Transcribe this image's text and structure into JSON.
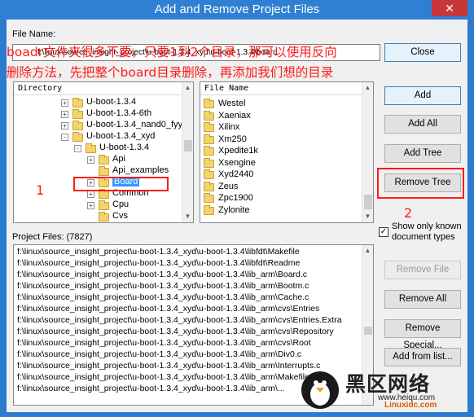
{
  "window": {
    "title": "Add and Remove Project Files",
    "close": "✕"
  },
  "labels": {
    "file_name": "File Name:",
    "directory": "Directory",
    "file_name_header": "File Name",
    "project_files": "Project Files: (7827)"
  },
  "filename_input": {
    "value": "f:\\linux\\source_insight_project\\u-boot-1.3.4_xyd\\u-boot-1.3.4\\board"
  },
  "buttons": {
    "close": "Close",
    "add": "Add",
    "add_all": "Add All",
    "add_tree": "Add Tree",
    "remove_tree": "Remove Tree",
    "remove_file": "Remove File",
    "remove_all": "Remove All",
    "remove_special": "Remove Special...",
    "add_from_list": "Add from list..."
  },
  "show_only_known": {
    "label_line1": "Show only known",
    "label_line2": "document types",
    "checked": true,
    "mark": "✓"
  },
  "directory_tree": [
    {
      "label": "U-boot-1.3.4",
      "expander": "+"
    },
    {
      "label": "U-boot-1.3.4-6th",
      "expander": "+"
    },
    {
      "label": "U-boot-1.3.4_nand0_fyy",
      "expander": "+"
    },
    {
      "label": "U-boot-1.3.4_xyd",
      "expander": "-"
    },
    {
      "label": "U-boot-1.3.4",
      "expander": "-"
    },
    {
      "label": "Api",
      "expander": "+"
    },
    {
      "label": "Api_examples",
      "expander": ""
    },
    {
      "label": "Board",
      "expander": "+"
    },
    {
      "label": "Common",
      "expander": "+"
    },
    {
      "label": "Cpu",
      "expander": "+"
    },
    {
      "label": "Cvs",
      "expander": ""
    }
  ],
  "file_list": [
    "Westel",
    "Xaeniax",
    "Xilinx",
    "Xm250",
    "Xpedite1k",
    "Xsengine",
    "Xyd2440",
    "Zeus",
    "Zpc1900",
    "Zylonite"
  ],
  "project_files": [
    "f:\\linux\\source_insight_project\\u-boot-1.3.4_xyd\\u-boot-1.3.4\\libfdt\\Makefile",
    "f:\\linux\\source_insight_project\\u-boot-1.3.4_xyd\\u-boot-1.3.4\\libfdt\\Readme",
    "f:\\linux\\source_insight_project\\u-boot-1.3.4_xyd\\u-boot-1.3.4\\lib_arm\\Board.c",
    "f:\\linux\\source_insight_project\\u-boot-1.3.4_xyd\\u-boot-1.3.4\\lib_arm\\Bootm.c",
    "f:\\linux\\source_insight_project\\u-boot-1.3.4_xyd\\u-boot-1.3.4\\lib_arm\\Cache.c",
    "f:\\linux\\source_insight_project\\u-boot-1.3.4_xyd\\u-boot-1.3.4\\lib_arm\\cvs\\Entries",
    "f:\\linux\\source_insight_project\\u-boot-1.3.4_xyd\\u-boot-1.3.4\\lib_arm\\cvs\\Entries.Extra",
    "f:\\linux\\source_insight_project\\u-boot-1.3.4_xyd\\u-boot-1.3.4\\lib_arm\\cvs\\Repository",
    "f:\\linux\\source_insight_project\\u-boot-1.3.4_xyd\\u-boot-1.3.4\\lib_arm\\cvs\\Root",
    "f:\\linux\\source_insight_project\\u-boot-1.3.4_xyd\\u-boot-1.3.4\\lib_arm\\Div0.c",
    "f:\\linux\\source_insight_project\\u-boot-1.3.4_xyd\\u-boot-1.3.4\\lib_arm\\Interrupts.c",
    "f:\\linux\\source_insight_project\\u-boot-1.3.4_xyd\\u-boot-1.3.4\\lib_arm\\Makefile",
    "f:\\linux\\source_insight_project\\u-boot-1.3.4_xyd\\u-boot-1.3.4\\lib_arm\\..."
  ],
  "annotation": {
    "line1": "boadr文件夹很多不要，只要1到2个目录，那可以使用反向",
    "line2": "删除方法，先把整个board目录删除，再添加我们想的目录",
    "marker1": "1",
    "marker2": "2",
    "color": "#ff1a1a"
  },
  "watermark": {
    "brand": "黑区网络",
    "url": "www.heiqu.com",
    "site": "Linuxidc.com"
  }
}
